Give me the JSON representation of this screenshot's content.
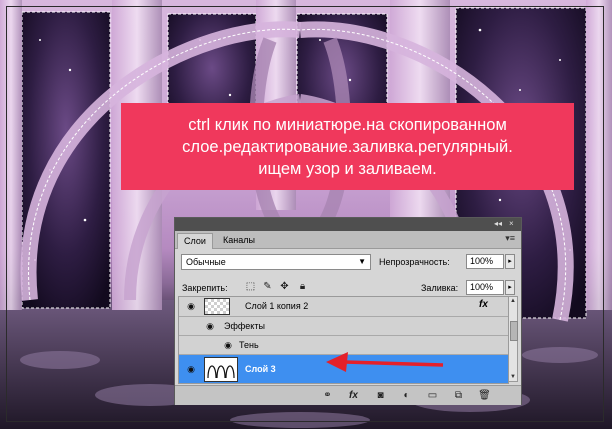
{
  "callout": {
    "lines": [
      "ctrl клик по миниатюре.на скопированном",
      "слое.редактирование.заливка.регулярный.",
      "ищем узор и заливаем."
    ]
  },
  "layers_panel": {
    "tabs": [
      "Слои",
      "Каналы"
    ],
    "blend_mode": "Обычные",
    "opacity_label": "Непрозрачность:",
    "opacity_value": "100%",
    "lock_label": "Закрепить:",
    "fill_label": "Заливка:",
    "fill_value": "100%",
    "layers": [
      {
        "name": "Слой 1 копия 2",
        "fx": "fx"
      },
      {
        "name": "Эффекты"
      },
      {
        "name": "Тень"
      },
      {
        "name": "Слой 3"
      }
    ],
    "icons": {
      "collapse": "collapse-icon",
      "close": "close-icon",
      "menu": "panel-menu-icon",
      "eye": "eye-icon",
      "lock_transparency": "lock-transparency-icon",
      "lock_paint": "lock-paint-icon",
      "lock_move": "lock-move-icon",
      "lock_all": "lock-all-icon",
      "link": "link-icon",
      "fx": "fx-icon",
      "mask": "mask-icon",
      "adjustment": "adjustment-icon",
      "group": "folder-icon",
      "new_layer": "new-layer-icon",
      "delete": "trash-icon"
    }
  },
  "colors": {
    "callout_bg": "#f0385c",
    "selection": "#3e8ff0",
    "arrow": "#e5202a"
  }
}
